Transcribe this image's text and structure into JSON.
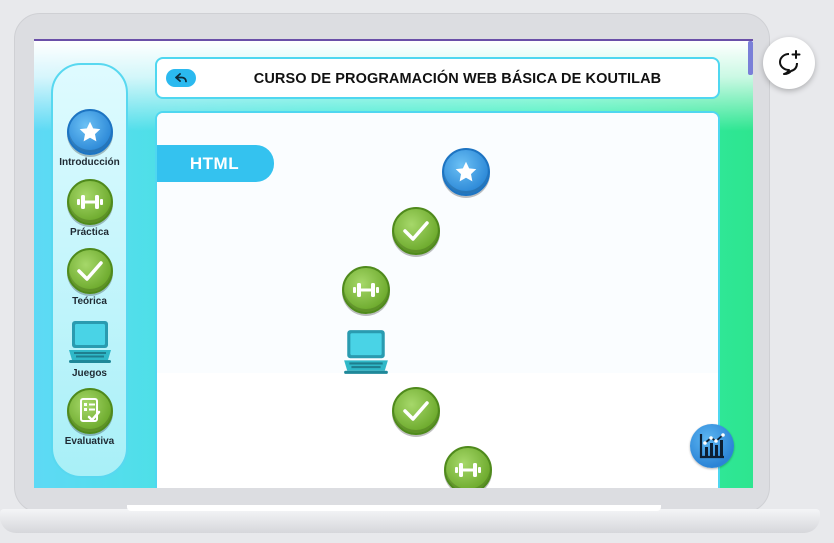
{
  "header": {
    "title": "CURSO DE PROGRAMACIÓN WEB BÁSICA DE KOUTILAB",
    "back_icon": "back-arrow-icon"
  },
  "sidebar": {
    "items": [
      {
        "label": "Introducción",
        "icon": "star-icon",
        "color": "#2e8ad8"
      },
      {
        "label": "Práctica",
        "icon": "dumbbell-icon",
        "color": "#6eab2e"
      },
      {
        "label": "Teórica",
        "icon": "check-icon",
        "color": "#6eab2e"
      },
      {
        "label": "Juegos",
        "icon": "laptop-icon",
        "color": "#2fb8c8"
      },
      {
        "label": "Evaluativa",
        "icon": "test-sheet-icon",
        "color": "#6eab2e"
      }
    ]
  },
  "content": {
    "section_label": "HTML",
    "path_nodes": [
      {
        "icon": "star-icon"
      },
      {
        "icon": "check-icon"
      },
      {
        "icon": "dumbbell-icon"
      },
      {
        "icon": "laptop-icon"
      },
      {
        "icon": "check-icon"
      },
      {
        "icon": "dumbbell-icon"
      }
    ]
  },
  "floating": {
    "stats_icon": "stats-chart-icon",
    "chat_icon": "add-comment-icon"
  },
  "colors": {
    "accent": "#34c2ef",
    "green": "#6eab2e",
    "blue": "#2e8ad8"
  }
}
